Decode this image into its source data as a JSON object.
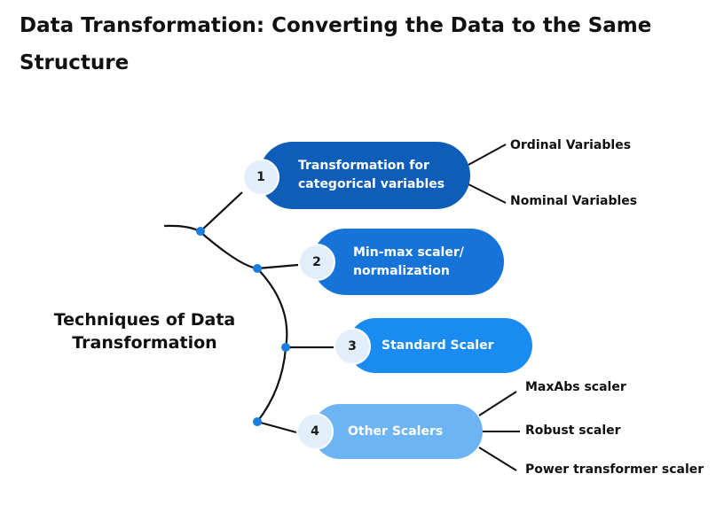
{
  "page": {
    "title": "Data Transformation: Converting the Data to the Same Structure"
  },
  "diagram": {
    "center_label": "Techniques of Data Transformation",
    "colors": {
      "technique_1": "#0e5db9",
      "technique_2": "#1673d8",
      "technique_3": "#1a8bf0",
      "technique_4": "#6db4f5",
      "badge": "#e3eefb",
      "connector_dot": "#1a7de0",
      "line": "#111111"
    },
    "techniques": [
      {
        "number": "1",
        "label": "Transformation for categorical variables",
        "children": [
          "Ordinal Variables",
          "Nominal Variables"
        ]
      },
      {
        "number": "2",
        "label": "Min-max scaler/ normalization",
        "children": []
      },
      {
        "number": "3",
        "label": "Standard Scaler",
        "children": []
      },
      {
        "number": "4",
        "label": "Other Scalers",
        "children": [
          "MaxAbs scaler",
          "Robust scaler",
          "Power transformer scaler"
        ]
      }
    ]
  }
}
